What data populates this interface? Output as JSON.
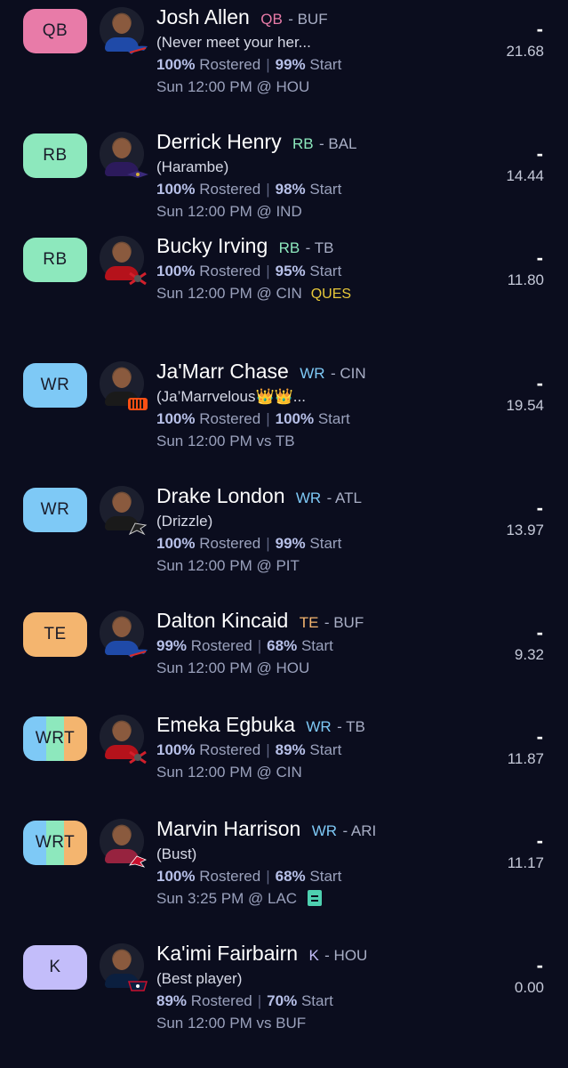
{
  "colors": {
    "background": "#0b0d1e",
    "qb": "#e87ba8",
    "rb": "#8de8bd",
    "wr": "#7ec9f6",
    "te": "#f4b56f",
    "k": "#c3bdfa",
    "ques": "#e8c93a"
  },
  "players": [
    {
      "slot": "QB",
      "name": "Josh Allen",
      "position": "QB",
      "team": "- BUF",
      "note": "(Never meet your her...",
      "rostered_pct": "100%",
      "rostered_label": "Rostered",
      "start_pct": "99%",
      "start_label": "Start",
      "game": "Sun 12:00 PM @ HOU",
      "status": "",
      "dash": "-",
      "projection": "21.68",
      "icon": "bills-logo-icon"
    },
    {
      "slot": "RB",
      "name": "Derrick Henry",
      "position": "RB",
      "team": "- BAL",
      "note": "(Harambe)",
      "rostered_pct": "100%",
      "rostered_label": "Rostered",
      "start_pct": "98%",
      "start_label": "Start",
      "game": "Sun 12:00 PM @ IND",
      "status": "",
      "dash": "-",
      "projection": "14.44",
      "icon": "ravens-logo-icon"
    },
    {
      "slot": "RB",
      "name": "Bucky Irving",
      "position": "RB",
      "team": "- TB",
      "note": "",
      "rostered_pct": "100%",
      "rostered_label": "Rostered",
      "start_pct": "95%",
      "start_label": "Start",
      "game": "Sun 12:00 PM @ CIN",
      "status": "QUES",
      "dash": "-",
      "projection": "11.80",
      "icon": "buccaneers-logo-icon"
    },
    {
      "slot": "WR",
      "name": "Ja'Marr Chase",
      "position": "WR",
      "team": "- CIN",
      "note": "(Ja’Marrvelous👑👑...",
      "rostered_pct": "100%",
      "rostered_label": "Rostered",
      "start_pct": "100%",
      "start_label": "Start",
      "game": "Sun 12:00 PM vs TB",
      "status": "",
      "dash": "-",
      "projection": "19.54",
      "icon": "bengals-logo-icon"
    },
    {
      "slot": "WR",
      "name": "Drake London",
      "position": "WR",
      "team": "- ATL",
      "note": "(Drizzle)",
      "rostered_pct": "100%",
      "rostered_label": "Rostered",
      "start_pct": "99%",
      "start_label": "Start",
      "game": "Sun 12:00 PM @ PIT",
      "status": "",
      "dash": "-",
      "projection": "13.97",
      "icon": "falcons-logo-icon"
    },
    {
      "slot": "TE",
      "name": "Dalton Kincaid",
      "position": "TE",
      "team": "- BUF",
      "note": "",
      "rostered_pct": "99%",
      "rostered_label": "Rostered",
      "start_pct": "68%",
      "start_label": "Start",
      "game": "Sun 12:00 PM @ HOU",
      "status": "",
      "dash": "-",
      "projection": "9.32",
      "icon": "bills-logo-icon"
    },
    {
      "slot": "WRT",
      "name": "Emeka Egbuka",
      "position": "WR",
      "team": "- TB",
      "note": "",
      "rostered_pct": "100%",
      "rostered_label": "Rostered",
      "start_pct": "89%",
      "start_label": "Start",
      "game": "Sun 12:00 PM @ CIN",
      "status": "",
      "dash": "-",
      "projection": "11.87",
      "icon": "buccaneers-logo-icon"
    },
    {
      "slot": "WRT",
      "name": "Marvin Harrison",
      "position": "WR",
      "team": "- ARI",
      "note": "(Bust)",
      "rostered_pct": "100%",
      "rostered_label": "Rostered",
      "start_pct": "68%",
      "start_label": "Start",
      "game": "Sun 3:25 PM @ LAC",
      "status": "news",
      "dash": "-",
      "projection": "11.17",
      "icon": "cardinals-logo-icon"
    },
    {
      "slot": "K",
      "name": "Ka'imi Fairbairn",
      "position": "K",
      "team": "- HOU",
      "note": "(Best player)",
      "rostered_pct": "89%",
      "rostered_label": "Rostered",
      "start_pct": "70%",
      "start_label": "Start",
      "game": "Sun 12:00 PM vs BUF",
      "status": "",
      "dash": "-",
      "projection": "0.00",
      "icon": "texans-logo-icon"
    }
  ]
}
